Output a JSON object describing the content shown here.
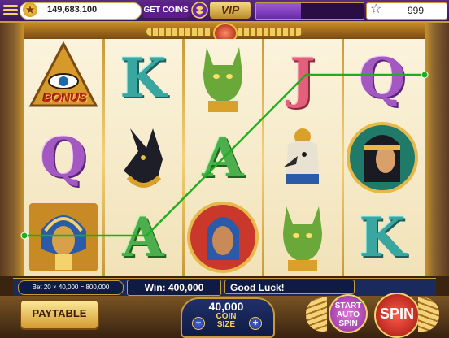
{
  "topbar": {
    "coins": "149,683,100",
    "get_coins_label": "GET COINS",
    "vip_label": "VIP",
    "level_value": "999",
    "xp_fraction": 0.42
  },
  "reels": {
    "columns": [
      [
        "eye-bonus",
        "letter-Q",
        "pharaoh-gold"
      ],
      [
        "letter-K",
        "anubis",
        "letter-A"
      ],
      [
        "bastet-cat",
        "letter-A",
        "pharaoh-portrait"
      ],
      [
        "letter-J",
        "horus",
        "bastet-cat"
      ],
      [
        "letter-Q",
        "cleopatra",
        "letter-K"
      ]
    ],
    "bonus_label": "BONUS",
    "winline_color": "#1fae1f"
  },
  "info": {
    "bet_formula": "Bet 20 × 40,000 = 800,000",
    "win_text": "Win: 400,000",
    "status_text": "Good Luck!"
  },
  "controls": {
    "paytable_label": "PAYTABLE",
    "coin_size_value": "40,000",
    "coin_label": "COIN",
    "size_label": "SIZE",
    "minus": "−",
    "plus": "+",
    "start_label": "START",
    "auto_label": "AUTO",
    "spin_small_label": "SPIN",
    "spin_label": "SPIN"
  }
}
